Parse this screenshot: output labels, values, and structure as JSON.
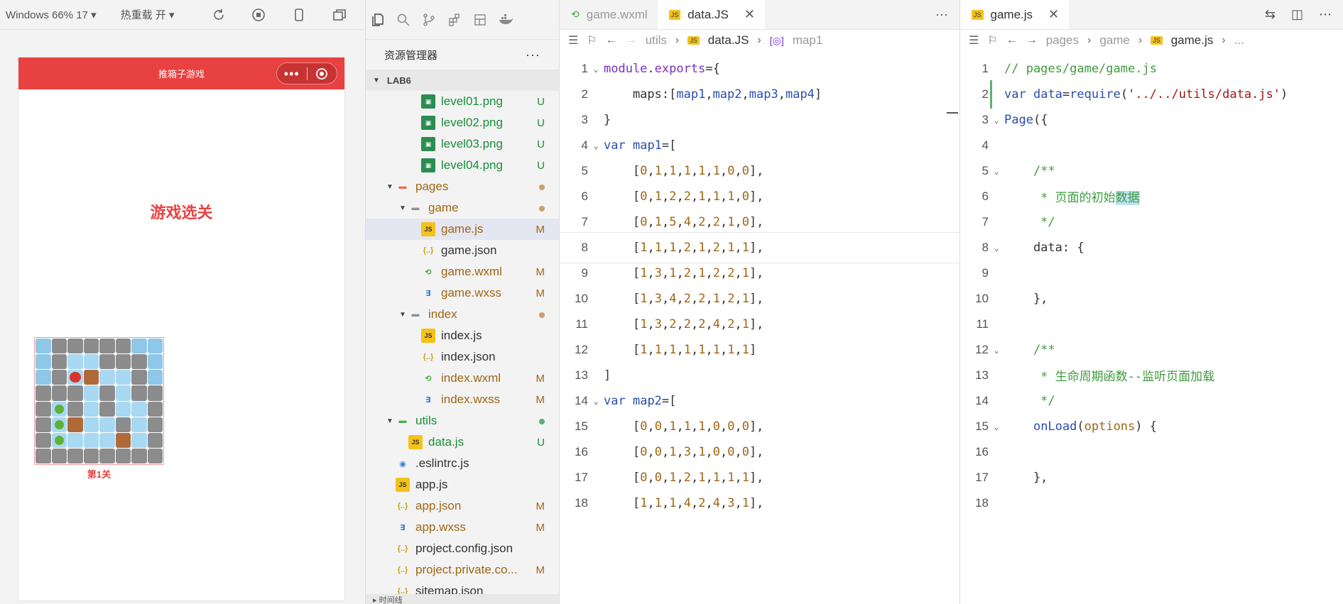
{
  "simulator": {
    "device": "Windows 66% 17",
    "hot_reload": "热重载 开",
    "nav_title": "推箱子游戏",
    "capsule_more": "•••",
    "page_title": "游戏选关",
    "level_label": "第1关",
    "board": [
      [
        0,
        1,
        1,
        1,
        1,
        1,
        0,
        0
      ],
      [
        0,
        1,
        2,
        2,
        1,
        1,
        1,
        0
      ],
      [
        0,
        1,
        5,
        4,
        2,
        2,
        1,
        0
      ],
      [
        1,
        1,
        1,
        2,
        1,
        2,
        1,
        1
      ],
      [
        1,
        3,
        1,
        2,
        1,
        2,
        2,
        1
      ],
      [
        1,
        3,
        4,
        2,
        2,
        1,
        2,
        1
      ],
      [
        1,
        3,
        2,
        2,
        2,
        4,
        2,
        1
      ],
      [
        1,
        1,
        1,
        1,
        1,
        1,
        1,
        1
      ]
    ]
  },
  "explorer": {
    "title": "资源管理器",
    "more": "···",
    "project": "LAB6",
    "footer": "时间线",
    "items": [
      {
        "label": "level01.png",
        "indent": 3,
        "icon": "png",
        "color": "green",
        "status": "U"
      },
      {
        "label": "level02.png",
        "indent": 3,
        "icon": "png",
        "color": "green",
        "status": "U"
      },
      {
        "label": "level03.png",
        "indent": 3,
        "icon": "png",
        "color": "green",
        "status": "U"
      },
      {
        "label": "level04.png",
        "indent": 3,
        "icon": "png",
        "color": "green",
        "status": "U"
      },
      {
        "label": "pages",
        "indent": 1,
        "icon": "folder-red",
        "color": "brown",
        "status": "dot",
        "twisty": "open"
      },
      {
        "label": "game",
        "indent": 2,
        "icon": "folder",
        "color": "brown",
        "status": "dot",
        "twisty": "open"
      },
      {
        "label": "game.js",
        "indent": 3,
        "icon": "js",
        "color": "brown",
        "status": "M",
        "selected": true
      },
      {
        "label": "game.json",
        "indent": 3,
        "icon": "json",
        "color": "normal",
        "status": ""
      },
      {
        "label": "game.wxml",
        "indent": 3,
        "icon": "wxml",
        "color": "brown",
        "status": "M"
      },
      {
        "label": "game.wxss",
        "indent": 3,
        "icon": "wxss",
        "color": "brown",
        "status": "M"
      },
      {
        "label": "index",
        "indent": 2,
        "icon": "folder",
        "color": "brown",
        "status": "dot",
        "twisty": "open"
      },
      {
        "label": "index.js",
        "indent": 3,
        "icon": "js",
        "color": "normal",
        "status": ""
      },
      {
        "label": "index.json",
        "indent": 3,
        "icon": "json",
        "color": "normal",
        "status": ""
      },
      {
        "label": "index.wxml",
        "indent": 3,
        "icon": "wxml",
        "color": "brown",
        "status": "M"
      },
      {
        "label": "index.wxss",
        "indent": 3,
        "icon": "wxss",
        "color": "brown",
        "status": "M"
      },
      {
        "label": "utils",
        "indent": 1,
        "icon": "folder-green",
        "color": "green",
        "status": "gdot",
        "twisty": "open"
      },
      {
        "label": "data.js",
        "indent": 2,
        "icon": "js",
        "color": "green",
        "status": "U"
      },
      {
        "label": ".eslintrc.js",
        "indent": 1,
        "icon": "eslint",
        "color": "normal",
        "status": ""
      },
      {
        "label": "app.js",
        "indent": 1,
        "icon": "js",
        "color": "normal",
        "status": ""
      },
      {
        "label": "app.json",
        "indent": 1,
        "icon": "json",
        "color": "brown",
        "status": "M"
      },
      {
        "label": "app.wxss",
        "indent": 1,
        "icon": "wxss",
        "color": "brown",
        "status": "M"
      },
      {
        "label": "project.config.json",
        "indent": 1,
        "icon": "json",
        "color": "normal",
        "status": ""
      },
      {
        "label": "project.private.co...",
        "indent": 1,
        "icon": "json",
        "color": "brown",
        "status": "M"
      },
      {
        "label": "sitemap.json",
        "indent": 1,
        "icon": "json",
        "color": "normal",
        "status": ""
      }
    ]
  },
  "editor1": {
    "tabs": [
      {
        "label": "game.wxml",
        "active": false
      },
      {
        "label": "data.JS",
        "active": true,
        "close": "✕"
      }
    ],
    "more": "···",
    "crumbs": [
      "utils",
      "data.JS",
      "map1"
    ],
    "lines": [
      "module.exports={",
      "    maps:[map1,map2,map3,map4]",
      "}",
      "var map1=[",
      "    [0,1,1,1,1,1,0,0],",
      "    [0,1,2,2,1,1,1,0],",
      "    [0,1,5,4,2,2,1,0],",
      "    [1,1,1,2,1,2,1,1],",
      "    [1,3,1,2,1,2,2,1],",
      "    [1,3,4,2,2,1,2,1],",
      "    [1,3,2,2,2,4,2,1],",
      "    [1,1,1,1,1,1,1,1]",
      "]",
      "var map2=[",
      "    [0,0,1,1,1,0,0,0],",
      "    [0,0,1,3,1,0,0,0],",
      "    [0,0,1,2,1,1,1,1],",
      "    [1,1,1,4,2,4,3,1],"
    ]
  },
  "editor2": {
    "tabs": [
      {
        "label": "game.js",
        "active": true,
        "close": "✕"
      }
    ],
    "crumbs": [
      "pages",
      "game",
      "game.js",
      "..."
    ],
    "lines": [
      "// pages/game/game.js",
      "var data=require('../../utils/data.js')",
      "Page({",
      "",
      "    /**",
      "     * 页面的初始数据",
      "     */",
      "    data: {",
      "",
      "    },",
      "",
      "    /**",
      "     * 生命周期函数--监听页面加载",
      "     */",
      "    onLoad(options) {",
      "",
      "    },",
      ""
    ]
  }
}
